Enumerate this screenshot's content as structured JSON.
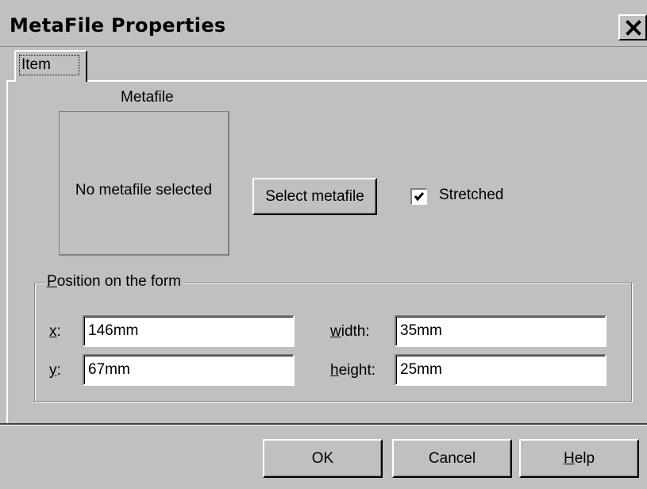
{
  "window": {
    "title": "MetaFile Properties",
    "close_icon": "close-icon"
  },
  "tabs": [
    {
      "label": "Item",
      "selected": true
    }
  ],
  "metafile": {
    "label": "Metafile",
    "preview_text": "No metafile selected",
    "select_button_label": "Select metafile",
    "stretched": {
      "label": "Stretched",
      "checked": true
    }
  },
  "position": {
    "group_label": "Position on the form",
    "x": {
      "label": "x:",
      "value": "146mm"
    },
    "y": {
      "label": "y:",
      "value": "67mm"
    },
    "width": {
      "label": "width:",
      "value": "35mm"
    },
    "height": {
      "label": "height:",
      "value": "25mm"
    }
  },
  "buttons": {
    "ok": "OK",
    "cancel": "Cancel",
    "help": "Help"
  },
  "colors": {
    "face": "#c0c0c0",
    "field": "#ffffff",
    "shadow": "#808080"
  }
}
